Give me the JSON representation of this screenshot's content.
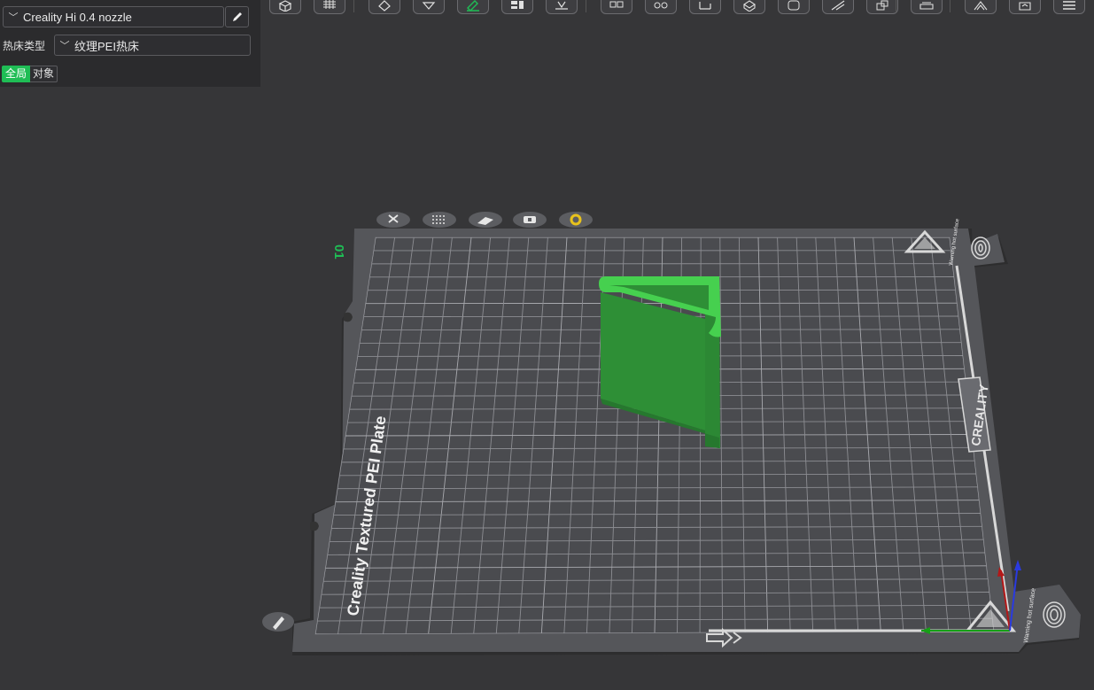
{
  "left_panel": {
    "printer": {
      "value": "Creality Hi 0.4 nozzle"
    },
    "bed_type": {
      "label": "热床类型",
      "value": "纹理PEI热床"
    },
    "scope": {
      "global_label": "全局",
      "object_label": "对象"
    }
  },
  "toolbar": {
    "buttons": [
      {
        "icon": "cube-view-icon"
      },
      {
        "icon": "grid-arrange-icon"
      },
      {
        "icon": "orient-icon"
      },
      {
        "icon": "lay-on-face-icon"
      },
      {
        "icon": "slice-plate-icon"
      },
      {
        "icon": "split-objects-icon"
      },
      {
        "icon": "cut-icon"
      },
      {
        "icon": "boolean-icon"
      },
      {
        "icon": "support-paint-icon"
      },
      {
        "icon": "measure-icon"
      },
      {
        "icon": "seam-paint-icon"
      },
      {
        "icon": "text-emboss-icon"
      },
      {
        "icon": "fuzzy-skin-icon"
      },
      {
        "icon": "assembly-icon"
      },
      {
        "icon": "brim-ears-icon"
      },
      {
        "icon": "mesh-boolean-icon"
      },
      {
        "icon": "variable-layer-icon"
      },
      {
        "icon": "color-paint-icon"
      },
      {
        "icon": "more-menu-icon"
      }
    ]
  },
  "plate": {
    "number": "01",
    "name": "Creality Textured PEI Plate",
    "brand": "CREALITY",
    "warning_text": "Warning hot surface",
    "colors": {
      "model": "#2e9a3a",
      "plate_number": "#1fbd55",
      "accent_green": "#1fbd55"
    },
    "plate_icons": [
      "delete-plate-icon",
      "arrange-plate-icon",
      "orient-plate-icon",
      "lock-plate-icon",
      "plate-settings-icon"
    ],
    "edit_icon": "pencil-icon"
  }
}
